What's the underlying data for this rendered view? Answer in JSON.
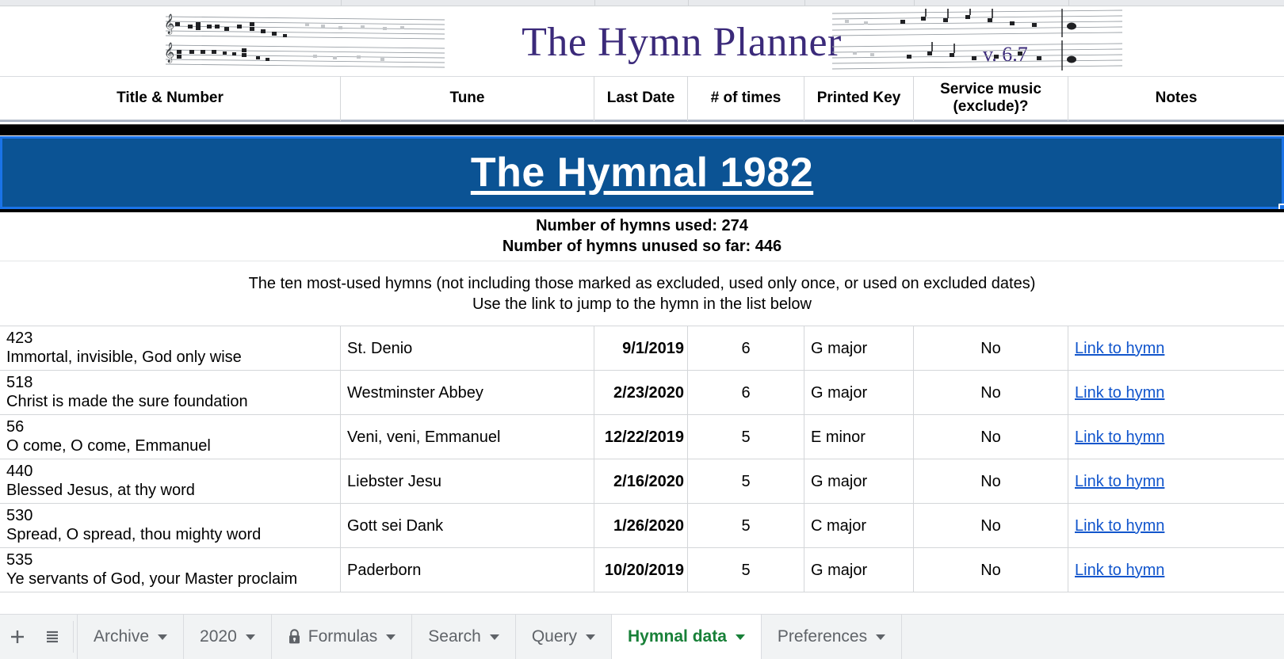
{
  "app": {
    "logo_title": "The Hymn Planner",
    "version": "v. 6.7"
  },
  "columns": [
    "Title & Number",
    "Tune",
    "Last Date",
    "# of times",
    "Printed Key",
    "Service music (exclude)?",
    "Notes"
  ],
  "banner": {
    "title": "The Hymnal 1982",
    "background": "#0b5394",
    "selection_border": "#1a73e8"
  },
  "summary": {
    "used": "Number of hymns used: 274",
    "unused": "Number of hymns unused so far: 446"
  },
  "description": {
    "line1": "The ten most-used hymns (not including those marked as excluded, used only once, or used on excluded dates)",
    "line2": "Use the link to jump to the hymn in the list below"
  },
  "link_label": "Link to hymn",
  "rows": [
    {
      "number": "423",
      "title": "Immortal, invisible, God only wise",
      "tune": "St. Denio",
      "last_date": "9/1/2019",
      "times": "6",
      "key": "G major",
      "service_music": "No",
      "notes": "Link to hymn"
    },
    {
      "number": "518",
      "title": "Christ is made the sure foundation",
      "tune": "Westminster Abbey",
      "last_date": "2/23/2020",
      "times": "6",
      "key": "G major",
      "service_music": "No",
      "notes": "Link to hymn"
    },
    {
      "number": "56",
      "title": "O come, O come, Emmanuel",
      "tune": "Veni, veni, Emmanuel",
      "last_date": "12/22/2019",
      "times": "5",
      "key": "E minor",
      "service_music": "No",
      "notes": "Link to hymn"
    },
    {
      "number": "440",
      "title": "Blessed Jesus, at thy word",
      "tune": "Liebster Jesu",
      "last_date": "2/16/2020",
      "times": "5",
      "key": "G major",
      "service_music": "No",
      "notes": "Link to hymn"
    },
    {
      "number": "530",
      "title": "Spread, O spread, thou mighty word",
      "tune": "Gott sei Dank",
      "last_date": "1/26/2020",
      "times": "5",
      "key": "C major",
      "service_music": "No",
      "notes": "Link to hymn"
    },
    {
      "number": "535",
      "title": "Ye servants of God, your Master proclaim",
      "tune": "Paderborn",
      "last_date": "10/20/2019",
      "times": "5",
      "key": "G major",
      "service_music": "No",
      "notes": "Link to hymn"
    }
  ],
  "sheetbar": {
    "add_label": "+",
    "all_sheets_label": "☰",
    "tabs": [
      {
        "label": "Archive",
        "locked": false,
        "active": false
      },
      {
        "label": "2020",
        "locked": false,
        "active": false
      },
      {
        "label": "Formulas",
        "locked": true,
        "active": false
      },
      {
        "label": "Search",
        "locked": false,
        "active": false
      },
      {
        "label": "Query",
        "locked": false,
        "active": false
      },
      {
        "label": "Hymnal data",
        "locked": false,
        "active": true
      },
      {
        "label": "Preferences",
        "locked": false,
        "active": false
      }
    ],
    "active_color": "#188038"
  }
}
